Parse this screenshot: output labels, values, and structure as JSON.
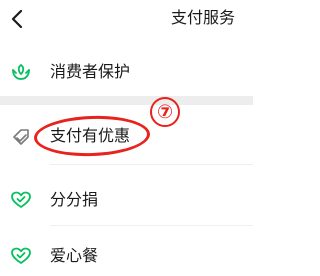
{
  "header": {
    "back_icon": "chevron-left-icon",
    "title": "支付服务"
  },
  "menu": {
    "items": [
      {
        "label": "消费者保护",
        "icon": "hands-leaf-icon",
        "color": "#07c160"
      },
      {
        "label": "支付有优惠",
        "icon": "discount-tag-icon",
        "color": "#7a7a7a"
      },
      {
        "label": "分分捐",
        "icon": "heart-check-icon",
        "color": "#07c160"
      },
      {
        "label": "爱心餐",
        "icon": "heart-check-icon",
        "color": "#07c160"
      }
    ]
  },
  "annotation": {
    "badge": "7",
    "color": "#e8221d"
  }
}
